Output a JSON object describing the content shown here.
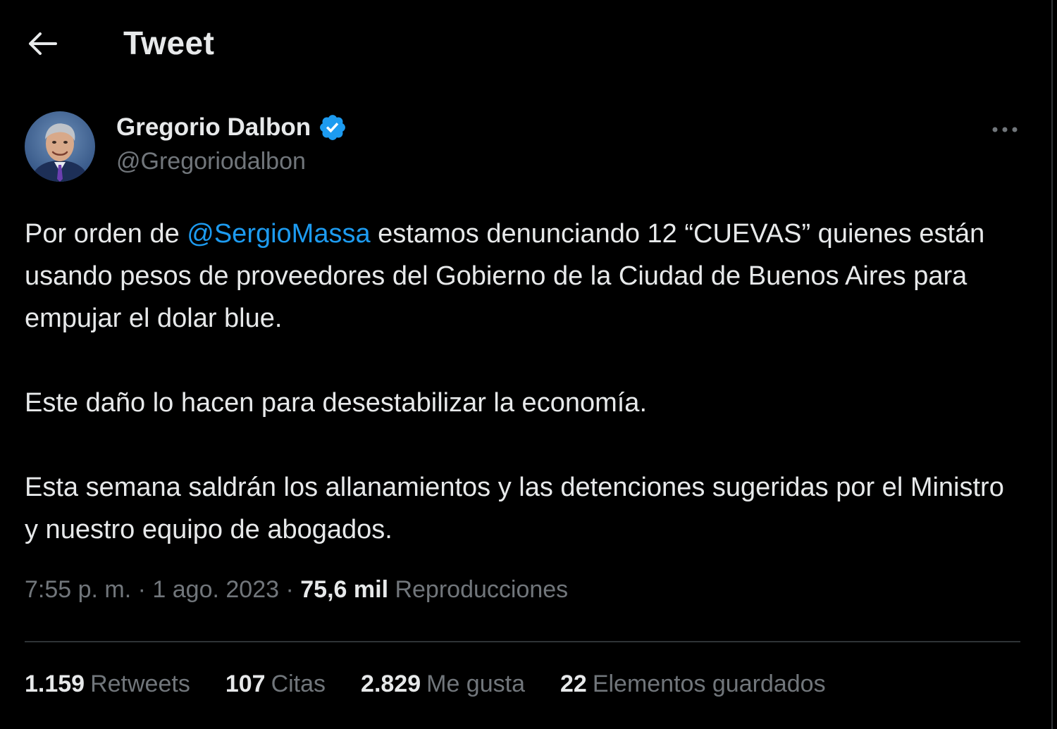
{
  "header": {
    "title": "Tweet",
    "back_icon": "arrow-left-icon"
  },
  "author": {
    "name": "Gregorio Dalbon",
    "handle": "@Gregoriodalbon",
    "verified": true,
    "verified_color": "#1d9bf0"
  },
  "tweet": {
    "p1_before": "Por orden de ",
    "mention": "@SergioMassa",
    "p1_after": " estamos denunciando 12 “CUEVAS” quienes están usando pesos de proveedores del Gobierno de la Ciudad de Buenos Aires para empujar el dolar blue.",
    "p2": "Este daño lo hacen para desestabilizar la economía.",
    "p3": "Esta semana saldrán los allanamientos y las detenciones sugeridas por el Ministro y nuestro equipo de abogados."
  },
  "meta": {
    "time": "7:55 p. m.",
    "separator": " · ",
    "date": "1 ago. 2023",
    "views_count": "75,6 mil",
    "views_label": "Reproducciones"
  },
  "stats": {
    "retweets_count": "1.159",
    "retweets_label": "Retweets",
    "quotes_count": "107",
    "quotes_label": "Citas",
    "likes_count": "2.829",
    "likes_label": "Me gusta",
    "bookmarks_count": "22",
    "bookmarks_label": "Elementos guardados"
  },
  "colors": {
    "background": "#000000",
    "text": "#e7e9ea",
    "secondary": "#71767b",
    "accent": "#1d9bf0",
    "divider": "#2f3336"
  }
}
